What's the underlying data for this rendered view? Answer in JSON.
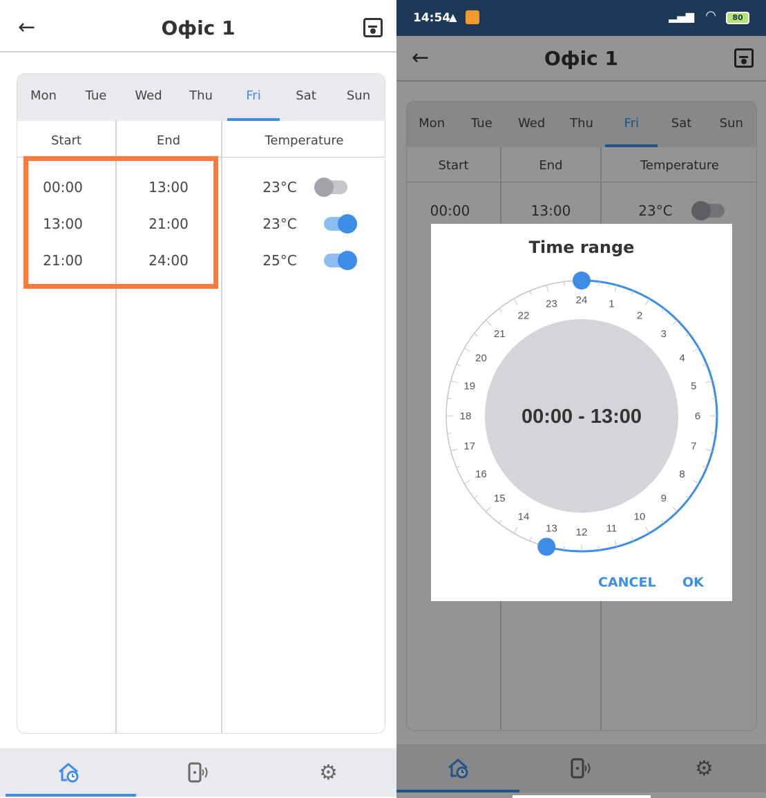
{
  "left_screen": {
    "header": {
      "back_icon": "arrow-left-icon",
      "title": "Офіс 1",
      "save_icon": "save-icon"
    },
    "days": [
      "Mon",
      "Tue",
      "Wed",
      "Thu",
      "Fri",
      "Sat",
      "Sun"
    ],
    "active_day": "Fri",
    "columns": {
      "start": "Start",
      "end": "End",
      "temperature": "Temperature"
    },
    "rows": [
      {
        "start": "00:00",
        "end": "13:00",
        "temp": "23°C",
        "enabled": false
      },
      {
        "start": "13:00",
        "end": "21:00",
        "temp": "23°C",
        "enabled": true
      },
      {
        "start": "21:00",
        "end": "24:00",
        "temp": "25°C",
        "enabled": true
      }
    ],
    "highlight_color": "#ff7a3c",
    "nav": [
      {
        "icon": "home-clock-icon",
        "active": true
      },
      {
        "icon": "device-signal-icon",
        "active": false
      },
      {
        "icon": "gear-icon",
        "active": false
      }
    ]
  },
  "right_screen": {
    "status_bar": {
      "time": "14:54",
      "battery": "80"
    },
    "header": {
      "title": "Офіс 1"
    },
    "days": [
      "Mon",
      "Tue",
      "Wed",
      "Thu",
      "Fri",
      "Sat",
      "Sun"
    ],
    "columns": {
      "start": "Start",
      "end": "End",
      "temperature": "Temperature"
    },
    "row": {
      "start": "00:00",
      "end": "13:00",
      "temp": "23°C"
    },
    "dialog": {
      "title": "Time range",
      "hours": [
        "24",
        "1",
        "2",
        "3",
        "4",
        "5",
        "6",
        "7",
        "8",
        "9",
        "10",
        "11",
        "12",
        "13",
        "14",
        "15",
        "16",
        "17",
        "18",
        "19",
        "20",
        "21",
        "22",
        "23"
      ],
      "range_start_hour": 0,
      "range_end_hour": 13,
      "range_label": "00:00 - 13:00",
      "cancel_label": "CANCEL",
      "ok_label": "OK"
    }
  },
  "colors": {
    "accent": "#3d8de8",
    "header_bg": "#1e3857",
    "tab_bg": "#e9eaee"
  }
}
